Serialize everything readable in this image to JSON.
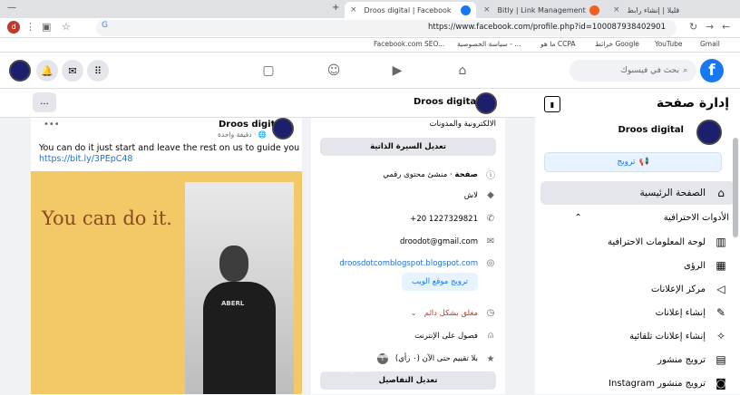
{
  "browser": {
    "tabs": [
      {
        "label": "Droos digital | Facebook",
        "active": true
      },
      {
        "label": "Bitly | Link Management",
        "active": false
      },
      {
        "label": "قليلا | إنشاء رابط",
        "active": false
      }
    ],
    "new_tab": "+",
    "url": "https://www.facebook.com/profile.php?id=100087938402901",
    "bookmarks": [
      "Gmail",
      "YouTube",
      "خرائط Google",
      "ما هو CCPA",
      "سياسة الخصوصية - ...",
      "Facebook.com SEO..."
    ]
  },
  "fb_header": {
    "search_placeholder": "بحث في فيسبوك",
    "logo": "f"
  },
  "page_header": {
    "page_name": "Droos digital",
    "more": "..."
  },
  "sidebar": {
    "title": "إدارة صفحة",
    "page_name": "Droos digital",
    "promote_label": "ترويج",
    "home_label": "الصفحة الرئيسية",
    "section_title": "الأدوات الاحترافية",
    "items": [
      {
        "label": "لوحة المعلومات الاحترافية",
        "icon": "dashboard-icon"
      },
      {
        "label": "الرؤى",
        "icon": "insights-icon"
      },
      {
        "label": "مركز الإعلانات",
        "icon": "megaphone-icon"
      },
      {
        "label": "إنشاء إعلانات",
        "icon": "pencil-icon"
      },
      {
        "label": "إنشاء إعلانات تلقائية",
        "icon": "magic-wand-icon"
      },
      {
        "label": "ترويج منشور",
        "icon": "post-icon"
      },
      {
        "label": "ترويج منشور Instagram",
        "icon": "instagram-icon"
      }
    ]
  },
  "post": {
    "author": "Droos digital",
    "time": "دقيقة واحدة · 🌐",
    "text": "You can do it just start and leave the rest on us to guide you",
    "link": "https://bit.ly/3PEpC48",
    "image_text": "You can do it.",
    "shirt_text": "ABERL"
  },
  "intro": {
    "top_text": "الالكترونية والمدونات",
    "edit_bio": "تعديل السيرة الذاتية",
    "category_label": "صفحة",
    "category_value": " · منشئ محتوى رقمي",
    "location": "لاش",
    "phone": "+20 1227329821",
    "email": "droodot@gmail.com",
    "website": "droosdotcomblogspot.blogspot.com",
    "promote_site": "ترويج موقع الويب",
    "hours": "مغلق بشكل دائم",
    "service": "فصول على الإنترنت",
    "rating": "بلا تقييم حتى الآن (٠ رأي)",
    "edit_details": "تعديل التفاصيل"
  },
  "watermark": {
    "top": "مستقل",
    "bottom": "mostaql.com"
  }
}
